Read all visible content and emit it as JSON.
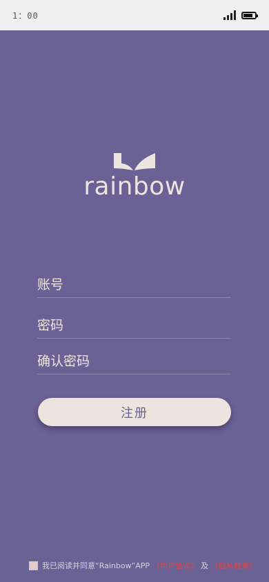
{
  "status_bar": {
    "time": "1：00",
    "battery_level": 0.7
  },
  "logo": {
    "text": "rainbow"
  },
  "form": {
    "account_placeholder": "账号",
    "password_placeholder": "密码",
    "confirm_password_placeholder": "确认密码",
    "register_label": "注册"
  },
  "agreement": {
    "text": "我已阅读并同意“Rainbow”APP",
    "user_agreement": "《用户协议》",
    "and": "及",
    "privacy_policy": "《隐私政策》"
  },
  "colors": {
    "background": "#6a6194",
    "accent": "#ede4df",
    "link": "#e0484b"
  }
}
